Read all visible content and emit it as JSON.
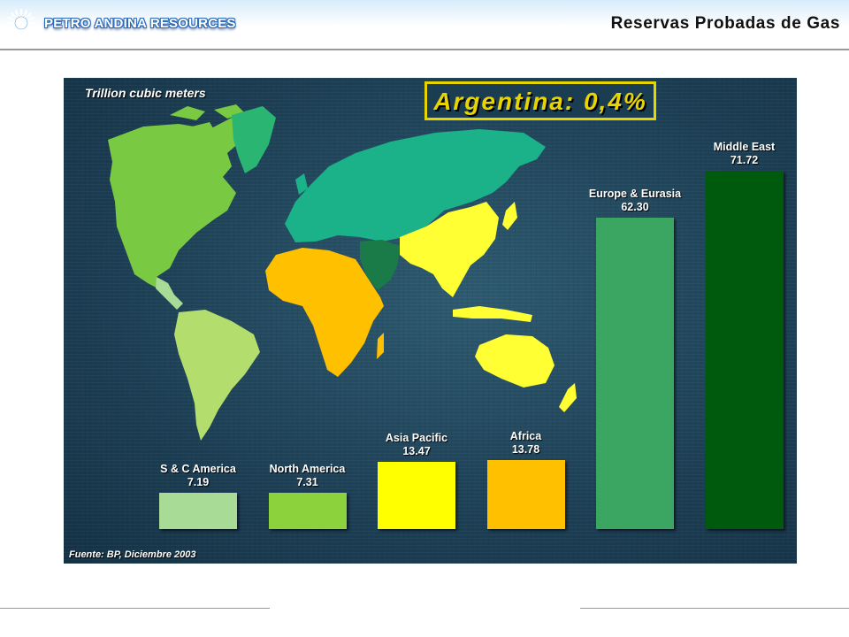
{
  "header": {
    "company": "PETRO ANDINA RESOURCES",
    "title": "Reservas Probadas de Gas"
  },
  "slide": {
    "unit_label": "Trillion cubic meters",
    "highlight": "Argentina: 0,4%",
    "source": "Fuente: BP, Diciembre 2003"
  },
  "chart_data": {
    "type": "bar",
    "title": "",
    "ylabel": "Trillion cubic meters",
    "categories": [
      "S & C America",
      "North America",
      "Asia Pacific",
      "Africa",
      "Europe & Eurasia",
      "Middle East"
    ],
    "values": [
      7.19,
      7.31,
      13.47,
      13.78,
      62.3,
      71.72
    ],
    "value_labels": [
      "7.19",
      "7.31",
      "13.47",
      "13.78",
      "62.30",
      "71.72"
    ],
    "colors": [
      "#a8dc96",
      "#8cd23c",
      "#ffff00",
      "#ffc000",
      "#3aa662",
      "#005a0e"
    ],
    "grid": false
  },
  "map_colors": {
    "north_america": "#7ac943",
    "greenland": "#2bb573",
    "south_america": "#b3de6d",
    "africa": "#ffc000",
    "eurasia": "#1bb28a",
    "middle_east": "#1a7a48",
    "asia_pacific": "#ffff33",
    "oceania": "#ffff33"
  }
}
